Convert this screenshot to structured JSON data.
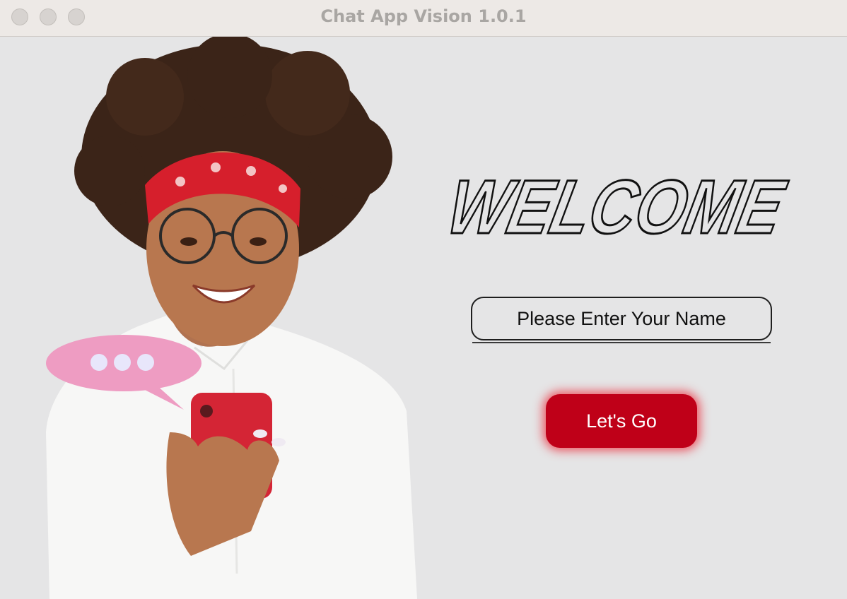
{
  "window": {
    "title": "Chat App Vision 1.0.1"
  },
  "welcome": {
    "heading": "WELCOME"
  },
  "form": {
    "name_placeholder": "Please Enter Your Name",
    "submit_label": "Let's  Go"
  },
  "colors": {
    "accent": "#bf0018",
    "glow": "#eb2837",
    "bubble": "#ee9cc2"
  },
  "icons": [
    "close-button",
    "minimize-button",
    "zoom-button",
    "chat-bubble-icon",
    "typing-dot-icon"
  ]
}
